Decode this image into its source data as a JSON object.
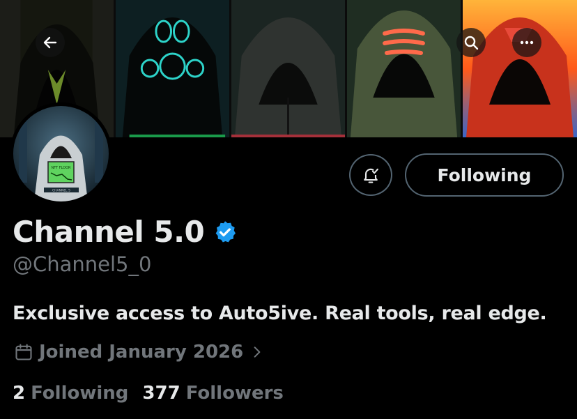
{
  "profile": {
    "display_name": "Channel 5.0",
    "handle": "@Channel5_0",
    "bio": "Exclusive access to Auto5ive. Real tools, real edge.",
    "joined": "Joined January 2026",
    "following_count": "2",
    "following_label": "Following",
    "followers_count": "377",
    "followers_label": "Followers",
    "verified_color": "#1d9bf0"
  },
  "actions": {
    "follow_button_label": "Following",
    "notify_icon": "bell-icon",
    "back_icon": "back-arrow-icon",
    "search_icon": "search-icon",
    "more_icon": "more-icon"
  },
  "avatar": {
    "screen_text": "NFT FLOOR",
    "caption": "CHANNEL 5"
  },
  "banner": {
    "panels": [
      "green-hood",
      "gas-mask-hood",
      "grey-hood",
      "orange-stripes-hood",
      "red-fire-hood"
    ]
  }
}
